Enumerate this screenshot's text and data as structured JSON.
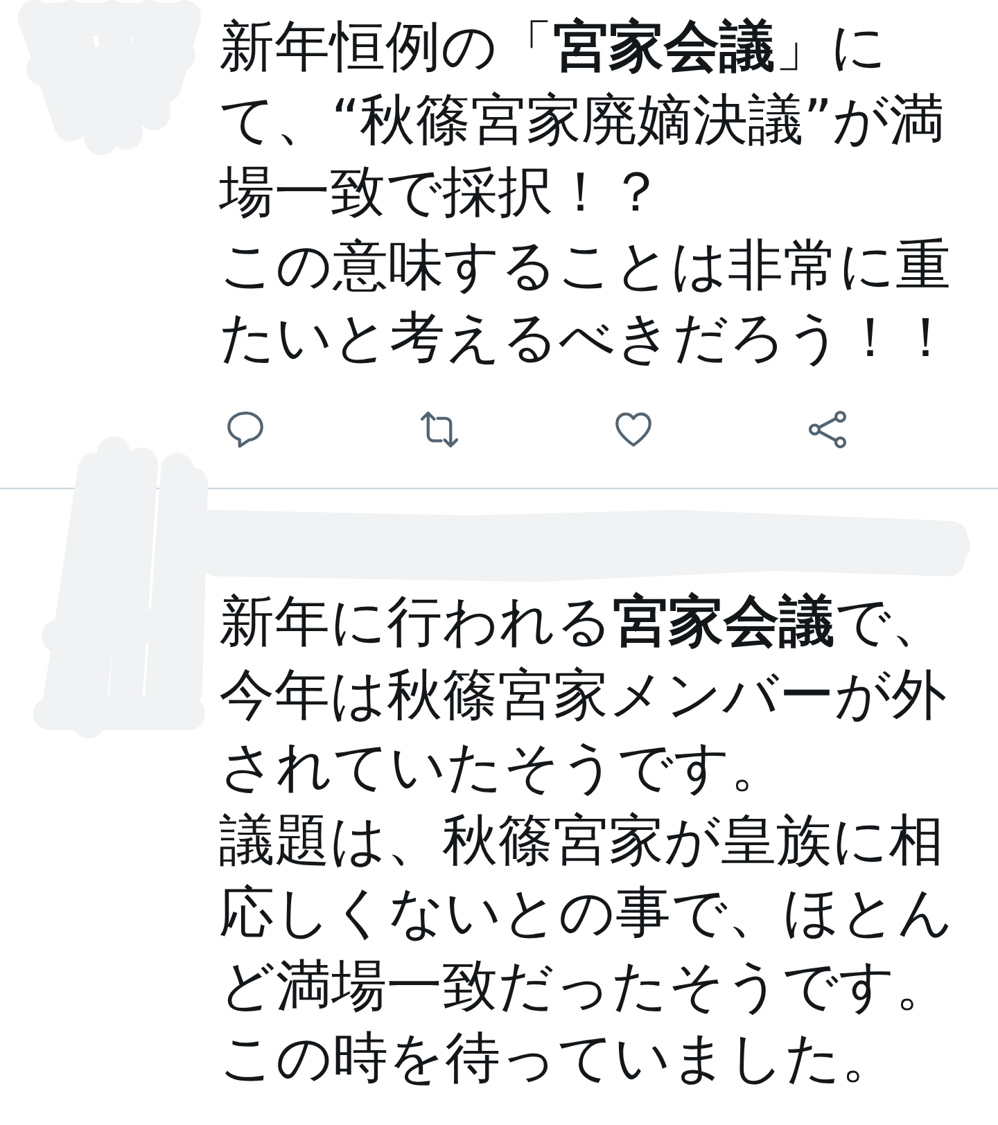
{
  "tweets": [
    {
      "avatar": {
        "redacted": true
      },
      "paragraphs": [
        "新年恒例の「**宮家会議**」にて、“秋篠宮家廃嫡決議”が満場一致で採択！？",
        "この意味することは非常に重たいと考えるべきだろう！！"
      ],
      "actions": [
        {
          "kind": "reply"
        },
        {
          "kind": "retweet"
        },
        {
          "kind": "like"
        },
        {
          "kind": "share"
        }
      ]
    },
    {
      "avatar": {
        "redacted": true
      },
      "header": {
        "redacted": true
      },
      "paragraphs": [
        "新年に行われる**宮家会議**で、今年は秋篠宮家メンバーが外されていたそうです。",
        "議題は、秋篠宮家が皇族に相応しくないとの事で、ほとんど満場一致だったそうです。",
        "この時を待っていました。"
      ]
    }
  ]
}
